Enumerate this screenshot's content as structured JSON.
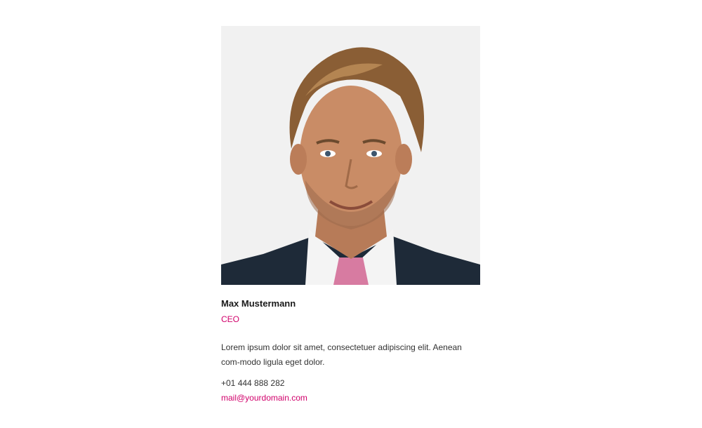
{
  "profile": {
    "name": "Max Mustermann",
    "role": "CEO",
    "bio": "Lorem ipsum dolor sit amet, consectetuer adipiscing elit. Aenean com-modo ligula eget dolor.",
    "phone": "+01 444 888 282",
    "email": "mail@yourdomain.com"
  },
  "colors": {
    "accent": "#d1006b",
    "text": "#333333",
    "heading": "#1a1a1a",
    "photo_background": "#f1f1f1"
  }
}
